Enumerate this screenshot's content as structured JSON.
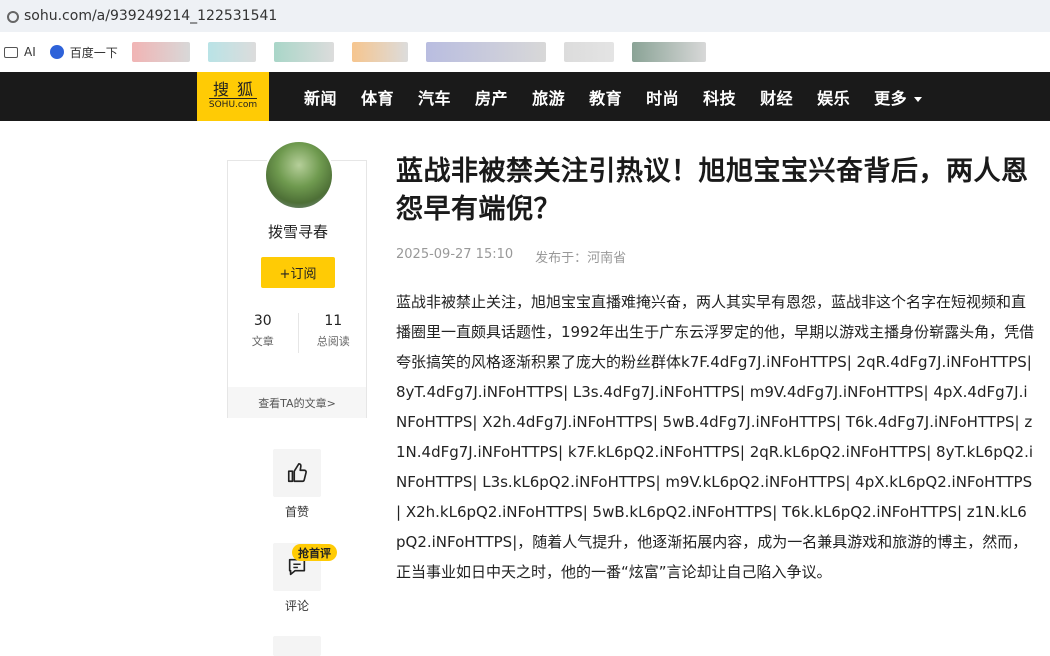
{
  "browser": {
    "url": "sohu.com/a/939249214_122531541",
    "bookmarks": [
      {
        "label": "AI",
        "icon": "folder-icon"
      },
      {
        "label": "百度一下",
        "icon": "baidu-paw-icon"
      }
    ]
  },
  "nav": {
    "logo_top": "搜狐",
    "logo_bottom": "SOHU.com",
    "items": [
      "新闻",
      "体育",
      "汽车",
      "房产",
      "旅游",
      "教育",
      "时尚",
      "科技",
      "财经",
      "娱乐"
    ],
    "more": "更多"
  },
  "author": {
    "name": "拨雪寻春",
    "subscribe": "+订阅",
    "articles_count": "30",
    "articles_label": "文章",
    "reads_count": "11",
    "reads_label": "总阅读",
    "see_articles": "查看TA的文章>"
  },
  "actions": {
    "like_label": "首赞",
    "comment_label": "评论",
    "hot_badge": "抢首评"
  },
  "article": {
    "title": "蓝战非被禁关注引热议！旭旭宝宝兴奋背后，两人恩怨早有端倪？",
    "date": "2025-09-27 15:10",
    "location": "发布于：河南省",
    "body": "蓝战非被禁止关注，旭旭宝宝直播难掩兴奋，两人其实早有恩怨，蓝战非这个名字在短视频和直播圈里一直颇具话题性，1992年出生于广东云浮罗定的他，早期以游戏主播身份崭露头角，凭借夸张搞笑的风格逐渐积累了庞大的粉丝群体k7F.4dFg7J.iNFoHTTPS| 2qR.4dFg7J.iNFoHTTPS| 8yT.4dFg7J.iNFoHTTPS| L3s.4dFg7J.iNFoHTTPS| m9V.4dFg7J.iNFoHTTPS| 4pX.4dFg7J.iNFoHTTPS| X2h.4dFg7J.iNFoHTTPS| 5wB.4dFg7J.iNFoHTTPS| T6k.4dFg7J.iNFoHTTPS| z1N.4dFg7J.iNFoHTTPS| k7F.kL6pQ2.iNFoHTTPS| 2qR.kL6pQ2.iNFoHTTPS| 8yT.kL6pQ2.iNFoHTTPS| L3s.kL6pQ2.iNFoHTTPS| m9V.kL6pQ2.iNFoHTTPS| 4pX.kL6pQ2.iNFoHTTPS| X2h.kL6pQ2.iNFoHTTPS| 5wB.kL6pQ2.iNFoHTTPS| T6k.kL6pQ2.iNFoHTTPS| z1N.kL6pQ2.iNFoHTTPS|，随着人气提升，他逐渐拓展内容，成为一名兼具游戏和旅游的博主，然而，正当事业如日中天之时，他的一番“炫富”言论却让自己陷入争议。"
  },
  "colors": {
    "brand": "#ffcb05",
    "navbar": "#1a1a1a"
  }
}
